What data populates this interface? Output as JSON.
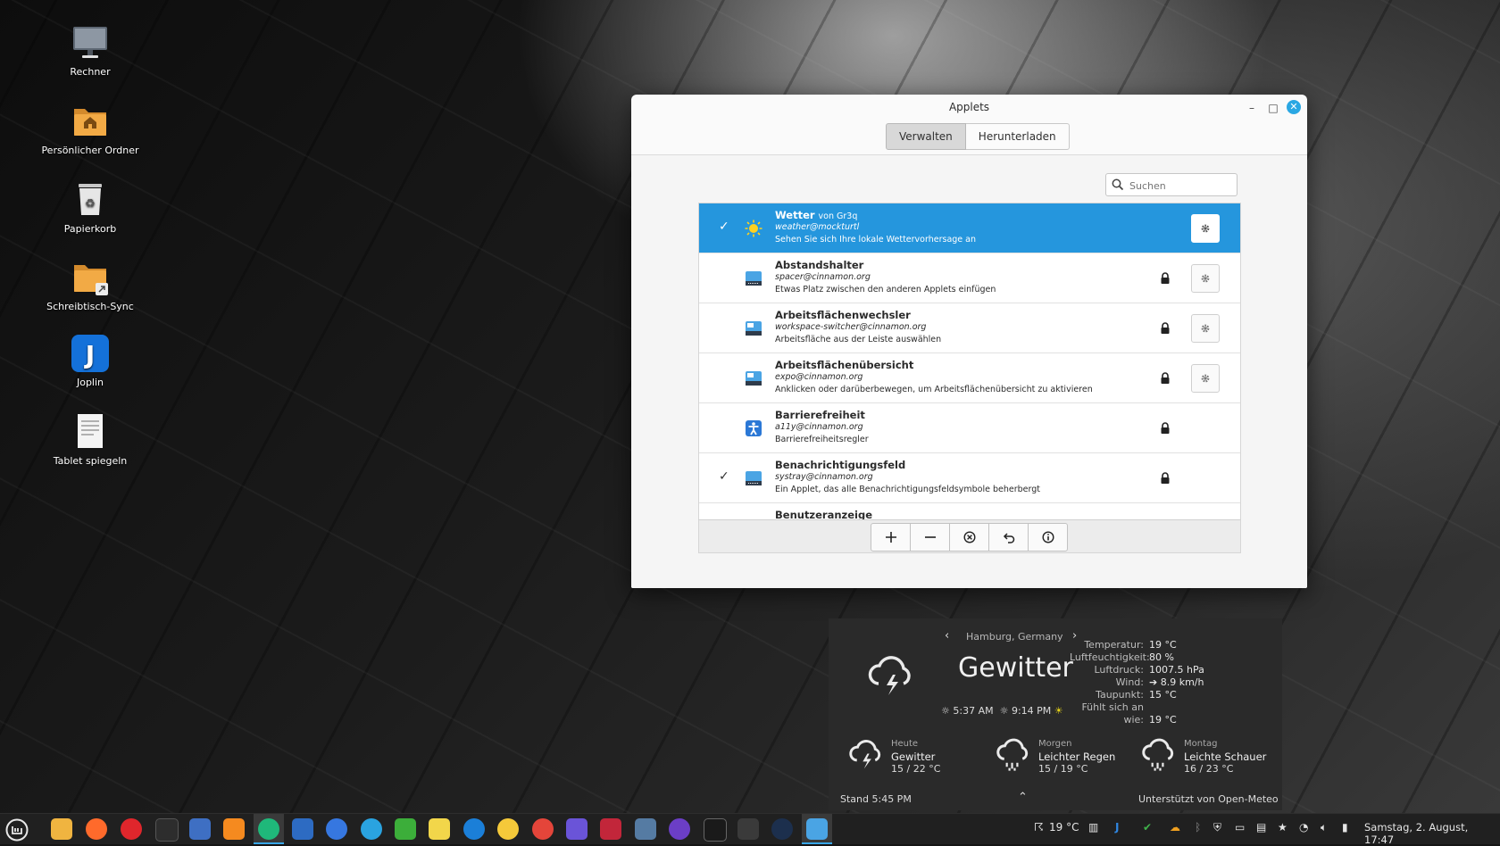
{
  "desktop": {
    "icons": [
      {
        "label": "Rechner"
      },
      {
        "label": "Persönlicher Ordner"
      },
      {
        "label": "Papierkorb"
      },
      {
        "label": "Schreibtisch-Sync"
      },
      {
        "label": "Joplin"
      },
      {
        "label": "Tablet spiegeln"
      }
    ]
  },
  "window": {
    "title": "Applets",
    "tabs": [
      "Verwalten",
      "Herunterladen"
    ],
    "search_placeholder": "Suchen",
    "applets": [
      {
        "name": "Wetter",
        "by": "von Gr3q",
        "uuid": "weather@mockturtl",
        "desc": "Sehen Sie sich Ihre lokale Wettervorhersage an",
        "enabled": true,
        "selected": true,
        "locked": false,
        "configurable": true
      },
      {
        "name": "Abstandshalter",
        "by": "",
        "uuid": "spacer@cinnamon.org",
        "desc": "Etwas Platz zwischen den anderen Applets einfügen",
        "enabled": false,
        "selected": false,
        "locked": true,
        "configurable": true
      },
      {
        "name": "Arbeitsflächenwechsler",
        "by": "",
        "uuid": "workspace-switcher@cinnamon.org",
        "desc": "Arbeitsfläche aus der Leiste auswählen",
        "enabled": false,
        "selected": false,
        "locked": true,
        "configurable": true
      },
      {
        "name": "Arbeitsflächenübersicht",
        "by": "",
        "uuid": "expo@cinnamon.org",
        "desc": "Anklicken oder darüberbewegen, um Arbeitsflächenübersicht zu aktivieren",
        "enabled": false,
        "selected": false,
        "locked": true,
        "configurable": true
      },
      {
        "name": "Barrierefreiheit",
        "by": "",
        "uuid": "a11y@cinnamon.org",
        "desc": "Barrierefreiheitsregler",
        "enabled": false,
        "selected": false,
        "locked": true,
        "configurable": false
      },
      {
        "name": "Benachrichtigungsfeld",
        "by": "",
        "uuid": "systray@cinnamon.org",
        "desc": "Ein Applet, das alle Benachrichtigungsfeldsymbole beherbergt",
        "enabled": true,
        "selected": false,
        "locked": true,
        "configurable": false
      },
      {
        "name": "Benutzeranzeige",
        "by": "",
        "uuid": "",
        "desc": "",
        "enabled": false,
        "selected": false,
        "locked": false,
        "configurable": false
      }
    ],
    "check_mark": "✓",
    "toolbar_icons": [
      "plus-icon",
      "minus-icon",
      "remove-circle-icon",
      "undo-icon",
      "info-icon"
    ]
  },
  "weather": {
    "location": "Hamburg, Germany",
    "condition": "Gewitter",
    "sunrise": "5:37 AM",
    "sunset": "9:14 PM",
    "details": [
      {
        "key": "Temperatur:",
        "value": "19 °C"
      },
      {
        "key": "Luftfeuchtigkeit:",
        "value": "80 %"
      },
      {
        "key": "Luftdruck:",
        "value": "1007.5 hPa"
      },
      {
        "key": "Wind:",
        "value": "➔ 8.9 km/h"
      },
      {
        "key": "Taupunkt:",
        "value": "15 °C"
      },
      {
        "key": "Fühlt sich an wie:",
        "value": "19 °C"
      }
    ],
    "forecast": [
      {
        "day": "Heute",
        "cond": "Gewitter",
        "temp": "15 / 22 °C"
      },
      {
        "day": "Morgen",
        "cond": "Leichter Regen",
        "temp": "15 / 19 °C"
      },
      {
        "day": "Montag",
        "cond": "Leichte Schauer",
        "temp": "16 / 23 °C"
      }
    ],
    "updated": "Stand 5:45 PM",
    "powered": "Unterstützt von Open-Meteo"
  },
  "taskbar": {
    "weather_temp": "19 °C",
    "clock": "Samstag, 2. August, 17:47"
  }
}
